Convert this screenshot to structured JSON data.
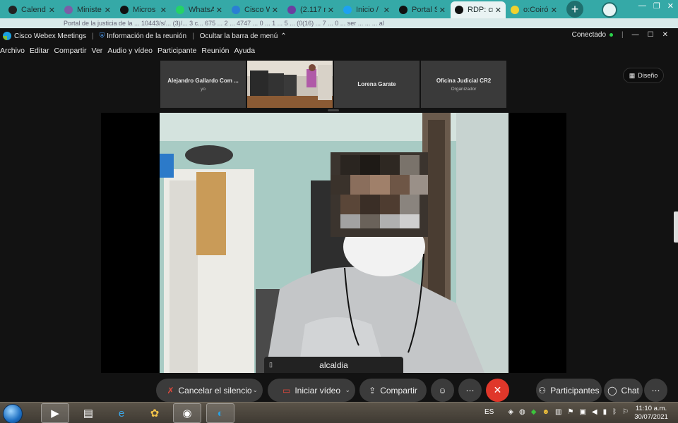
{
  "browser": {
    "tabs": [
      {
        "title": "Calend",
        "color": "#222",
        "icon": "calendar-icon"
      },
      {
        "title": "Ministe",
        "color": "#7b5ea7",
        "icon": "ministerio-icon"
      },
      {
        "title": "Micros",
        "color": "#111",
        "icon": "globe-icon"
      },
      {
        "title": "WhatsA",
        "color": "#25d366",
        "icon": "whatsapp-icon"
      },
      {
        "title": "Cisco W",
        "color": "#2a7fd4",
        "icon": "webex-icon"
      },
      {
        "title": "(2.117 n",
        "color": "#6b3fa0",
        "icon": "mail-icon"
      },
      {
        "title": "Inicio /",
        "color": "#1da1f2",
        "icon": "twitter-icon"
      },
      {
        "title": "Portal S",
        "color": "#111",
        "icon": "globe-icon"
      },
      {
        "title": "RDP: cr",
        "color": "#111",
        "icon": "globe-icon",
        "active": true
      },
      {
        "title": "o:Coirón",
        "color": "#f2d22e",
        "icon": "coiron-icon"
      }
    ],
    "new_tab": "+",
    "address_remnant": "Portal de la justicia de la ... 10443/s/... (3)/... 3 c... 675 ... 2 ... 4747 ... 0 ... 1 ... 5 ... (0(16) ... 7 ... 0 ... ser ... ... ... al"
  },
  "webex": {
    "app_name": "Cisco Webex Meetings",
    "meeting_info": "Información de la reunión",
    "hide_menu": "Ocultar la barra de menú",
    "status": "Conectado",
    "menu": [
      "Archivo",
      "Editar",
      "Compartir",
      "Ver",
      "Audio y vídeo",
      "Participante",
      "Reunión",
      "Ayuda"
    ],
    "participants": [
      {
        "name": "Alejandro Gallardo Com ...",
        "sub": "yo"
      },
      {
        "name": "",
        "sub": "",
        "video": true
      },
      {
        "name": "Lorena Garate",
        "sub": ""
      },
      {
        "name": "Oficina Judicial CR2",
        "sub": "Organizador"
      }
    ],
    "layout_label": "Diseño",
    "active_speaker": "alcaldia",
    "controls": {
      "mute": "Cancelar el silencio",
      "video": "Iniciar vídeo",
      "share": "Compartir",
      "participants": "Participantes",
      "chat": "Chat"
    }
  },
  "taskbar": {
    "language": "ES",
    "time": "11:10 a.m.",
    "date": "30/07/2021"
  }
}
